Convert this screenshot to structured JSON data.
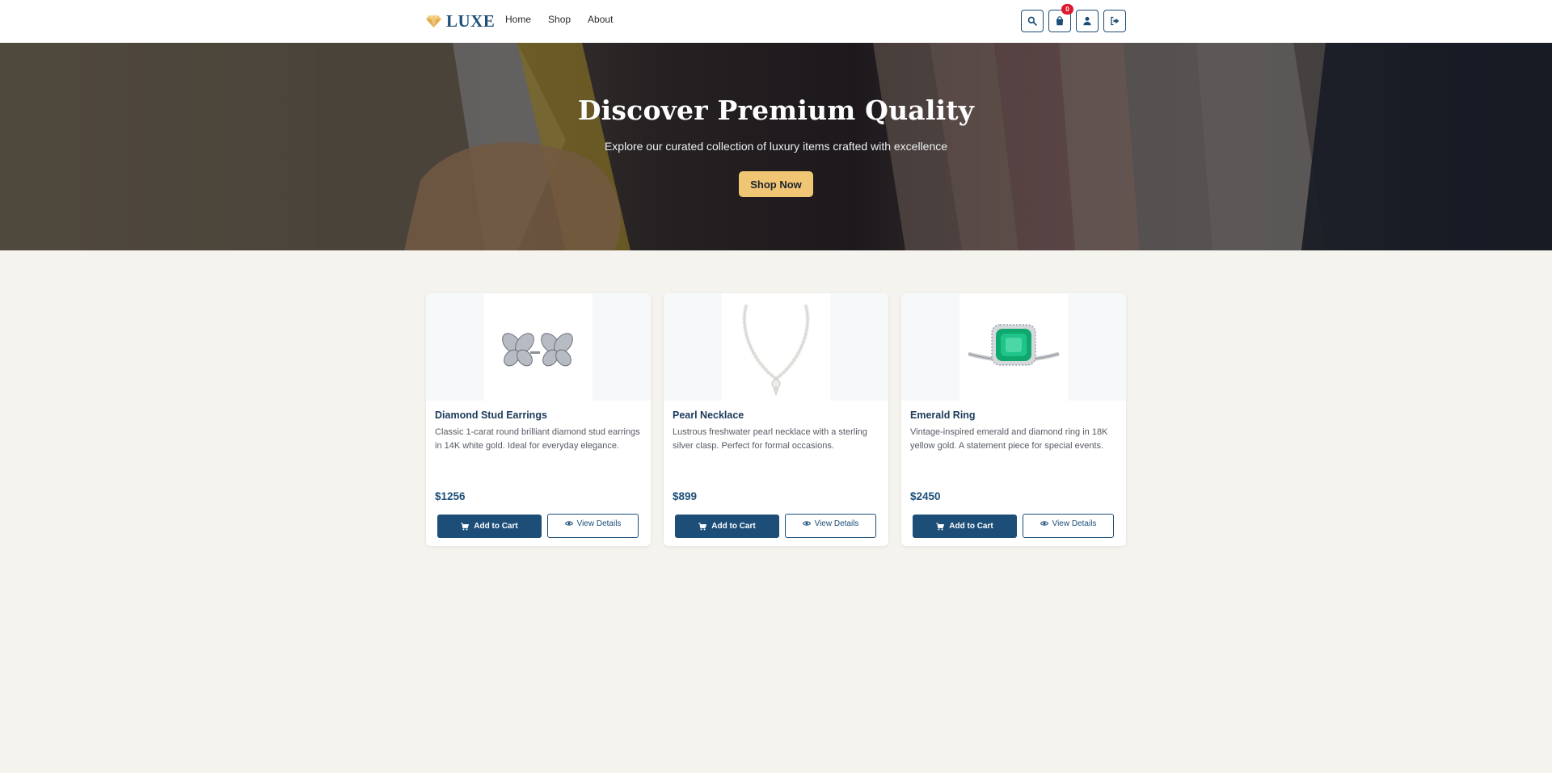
{
  "brand": {
    "name": "LUXE",
    "logo_icon": "gem-icon",
    "accent": "#1c4e78",
    "gem_color": "#f0c675"
  },
  "nav": {
    "links": [
      {
        "label": "Home"
      },
      {
        "label": "Shop"
      },
      {
        "label": "About"
      }
    ],
    "actions": [
      {
        "icon": "search-icon"
      },
      {
        "icon": "shopping-bag-icon",
        "badge": "0"
      },
      {
        "icon": "user-icon"
      },
      {
        "icon": "sign-out-icon"
      }
    ]
  },
  "hero": {
    "title": "Discover Premium Quality",
    "subtitle": "Explore our curated collection of luxury items crafted with excellence",
    "cta_label": "Shop Now",
    "cta_color": "#f0c675"
  },
  "products": [
    {
      "name": "Diamond Stud Earrings",
      "description": "Classic 1-carat round brilliant diamond stud earrings in 14K white gold. Ideal for everyday elegance.",
      "price": "$1256",
      "add_to_cart_label": "Add to Cart",
      "view_details_label": "View Details"
    },
    {
      "name": "Pearl Necklace",
      "description": "Lustrous freshwater pearl necklace with a sterling silver clasp. Perfect for formal occasions.",
      "price": "$899",
      "add_to_cart_label": "Add to Cart",
      "view_details_label": "View Details"
    },
    {
      "name": "Emerald Ring",
      "description": "Vintage-inspired emerald and diamond ring in 18K yellow gold. A statement piece for special events.",
      "price": "$2450",
      "add_to_cart_label": "Add to Cart",
      "view_details_label": "View Details"
    }
  ]
}
